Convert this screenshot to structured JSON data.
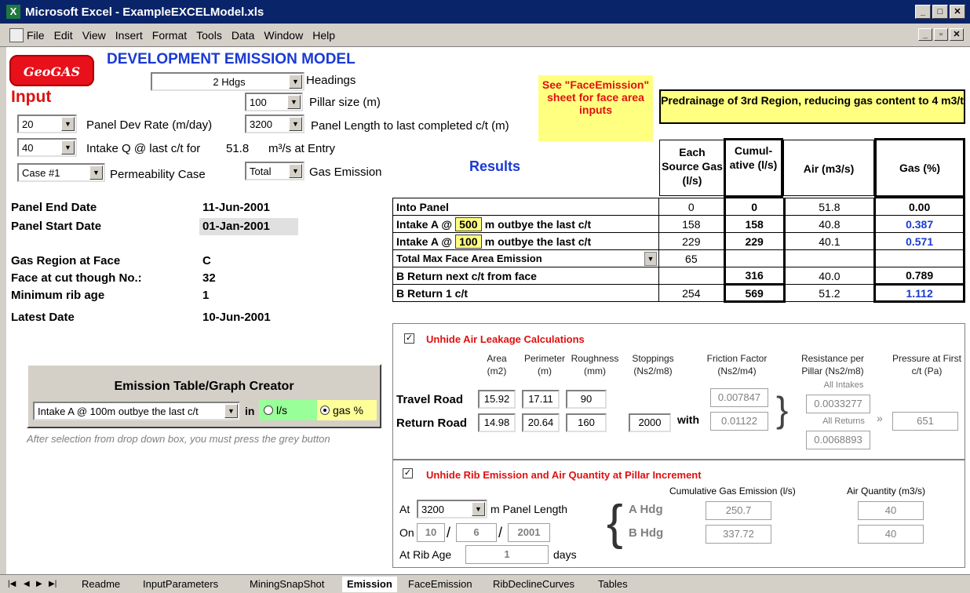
{
  "window": {
    "title": "Microsoft Excel - ExampleEXCELModel.xls",
    "icon": "excel-icon"
  },
  "menu": [
    "File",
    "Edit",
    "View",
    "Insert",
    "Format",
    "Tools",
    "Data",
    "Window",
    "Help"
  ],
  "logo": "GeoGAS",
  "model_title": "DEVELOPMENT EMISSION MODEL",
  "input_label": "Input",
  "inputs": {
    "headings_value": "2 Hdgs",
    "headings_label": "Headings",
    "pillar_value": "100",
    "pillar_label": "Pillar size (m)",
    "devrate_value": "20",
    "devrate_label": "Panel Dev Rate (m/day)",
    "panel_length_value": "3200",
    "panel_length_label": "Panel Length to last completed c/t (m)",
    "intake_value": "40",
    "intake_label": "Intake Q @ last c/t  for",
    "intake_entry_value": "51.8",
    "intake_entry_unit": "m³/s at Entry",
    "perm_value": "Case #1",
    "perm_label": "Permeability Case",
    "gas_value": "Total",
    "gas_label": "Gas Emission"
  },
  "see_note": "See \"FaceEmission\" sheet for face area inputs",
  "predrainage": "Predrainage of 3rd Region, reducing gas content to 4 m3/t",
  "results_label": "Results",
  "info": [
    {
      "label": "Panel End Date",
      "value": "11-Jun-2001"
    },
    {
      "label": "Panel Start Date",
      "value": "01-Jan-2001"
    },
    {
      "label": "Gas Region at Face",
      "value": "C"
    },
    {
      "label": "Face at cut though No.:",
      "value": "32"
    },
    {
      "label": "Minimum rib age",
      "value": "1"
    },
    {
      "label": "Latest Date",
      "value": "10-Jun-2001"
    }
  ],
  "table": {
    "headers": [
      "Each Source Gas (l/s)",
      "Cumul-ative (l/s)",
      "Air (m3/s)",
      "Gas (%)"
    ],
    "rows": [
      {
        "label": "Into Panel",
        "each": "0",
        "cum": "0",
        "air": "51.8",
        "gas": "0.00"
      },
      {
        "label": "Intake A @",
        "input": "500",
        "suffix": "m outbye the last c/t",
        "each": "158",
        "cum": "158",
        "air": "40.8",
        "gas": "0.387"
      },
      {
        "label": "Intake A @",
        "input": "100",
        "suffix": "m outbye the last c/t",
        "each": "229",
        "cum": "229",
        "air": "40.1",
        "gas": "0.571"
      },
      {
        "label": "Total Max Face Area Emission",
        "each": "65",
        "cum": "",
        "air": "",
        "gas": ""
      },
      {
        "label": "B Return next c/t from face",
        "each": "",
        "cum": "316",
        "air": "40.0",
        "gas": "0.789"
      },
      {
        "label": "B Return 1 c/t",
        "each": "254",
        "cum": "569",
        "air": "51.2",
        "gas": "1.112"
      }
    ]
  },
  "leak": {
    "checkbox_label": "Unhide Air Leakage Calculations",
    "col_area": "Area (m2)",
    "col_perim": "Perimeter (m)",
    "col_rough": "Roughness (mm)",
    "col_stop": "Stoppings (Ns2/m8)",
    "col_friction": "Friction Factor (Ns2/m4)",
    "col_resist": "Resistance per Pillar (Ns2/m8)",
    "col_pressure": "Pressure at First c/t (Pa)",
    "travel_label": "Travel Road",
    "travel": [
      "15.92",
      "17.11",
      "90"
    ],
    "return_label": "Return Road",
    "return": [
      "14.98",
      "20.64",
      "160"
    ],
    "stoppings": "2000",
    "with": "with",
    "friction": [
      "0.007847",
      "0.01122"
    ],
    "all_intakes": "All Intakes",
    "resist_intakes": "0.0033277",
    "all_returns": "All Returns",
    "resist_returns": "0.0068893",
    "pressure": "651"
  },
  "rib": {
    "checkbox_label": "Unhide Rib Emission and Air Quantity at Pillar Increment",
    "cum_label": "Cumulative Gas Emission (l/s)",
    "air_label": "Air Quantity (m3/s)",
    "at_label": "At",
    "at_value": "3200",
    "at_unit": "m  Panel Length",
    "on_label": "On",
    "day": "10",
    "month": "6",
    "year": "2001",
    "ribage_label": "At Rib Age",
    "ribage": "1",
    "days": "days",
    "a_hdg": "A Hdg",
    "b_hdg": "B Hdg",
    "a_gas": "250.7",
    "b_gas": "337.72",
    "a_air": "40",
    "b_air": "40"
  },
  "creator": {
    "title": "Emission Table/Graph Creator",
    "select": "Intake A @ 100m outbye the last c/t",
    "in": "in",
    "ls": "l/s",
    "gas": "gas %"
  },
  "note": "After selection from drop down box, you must press the grey button",
  "sheets": [
    "Readme",
    "InputParameters",
    "MiningSnapShot",
    "Emission",
    "FaceEmission",
    "RibDeclineCurves",
    "Tables"
  ]
}
